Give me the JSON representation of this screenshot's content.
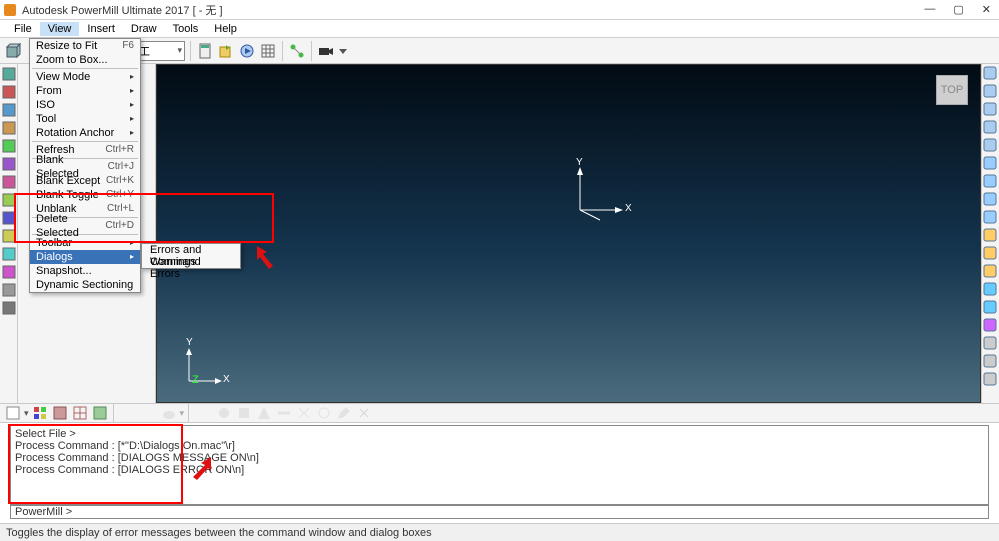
{
  "title": "Autodesk PowerMill Ultimate 2017    [ - 无 ]",
  "menubar": {
    "items": [
      "File",
      "View",
      "Insert",
      "Draw",
      "Tools",
      "Help"
    ],
    "active": 1
  },
  "toolbar": {
    "combo_label": "平行精加工"
  },
  "viewcube": "TOP",
  "axes": {
    "x": "X",
    "y": "Y",
    "z": "Z"
  },
  "view_menu": {
    "items": [
      {
        "label": "Resize to Fit",
        "shortcut": "F6"
      },
      {
        "label": "Zoom to Box..."
      },
      {
        "sep": true
      },
      {
        "label": "View Mode",
        "sub": true
      },
      {
        "label": "From",
        "sub": true
      },
      {
        "label": "ISO",
        "sub": true
      },
      {
        "label": "Tool",
        "sub": true
      },
      {
        "label": "Rotation Anchor",
        "sub": true
      },
      {
        "sep": true
      },
      {
        "label": "Refresh",
        "shortcut": "Ctrl+R"
      },
      {
        "sep": true
      },
      {
        "label": "Blank Selected",
        "shortcut": "Ctrl+J"
      },
      {
        "label": "Blank Except",
        "shortcut": "Ctrl+K"
      },
      {
        "label": "Blank Toggle",
        "shortcut": "Ctrl+Y"
      },
      {
        "label": "Unblank",
        "shortcut": "Ctrl+L"
      },
      {
        "sep": true
      },
      {
        "label": "Delete Selected",
        "shortcut": "Ctrl+D"
      },
      {
        "sep": true
      },
      {
        "label": "Toolbar",
        "sub": true
      },
      {
        "label": "Dialogs",
        "sub": true,
        "hov": true
      },
      {
        "label": "Snapshot..."
      },
      {
        "label": "Dynamic Sectioning"
      }
    ]
  },
  "submenu": {
    "items": [
      "Errors and Warnings",
      "Command Errors"
    ]
  },
  "cmdwin": {
    "lines": [
      "Select File >",
      "Process Command : [*\"D:\\Dialogs On.mac\"\\r]",
      "",
      "Process Command : [DIALOGS MESSAGE ON\\n]",
      "",
      "Process Command : [DIALOGS ERROR ON\\n]"
    ]
  },
  "cmdbar": "PowerMill >",
  "status": "Toggles the display of error messages between the command window and dialog boxes"
}
